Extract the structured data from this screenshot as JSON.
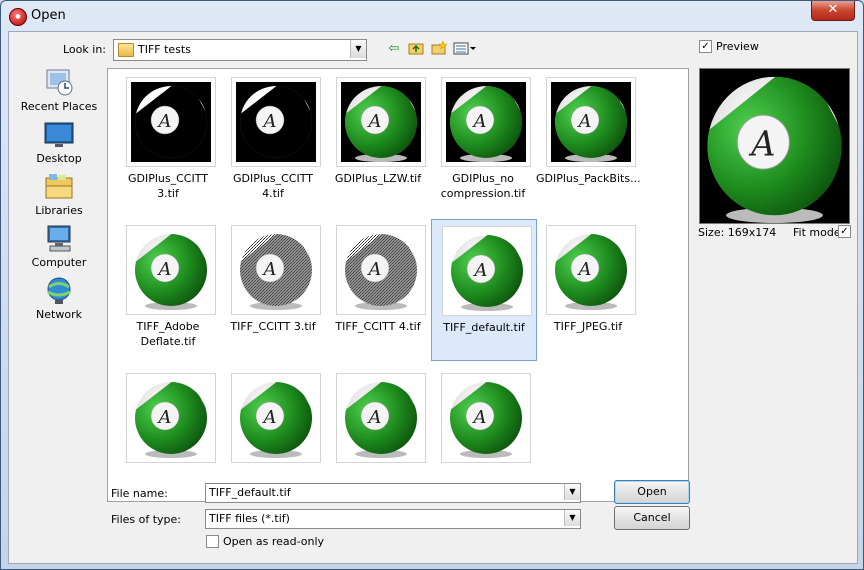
{
  "window": {
    "title": "Open",
    "app_icon": "app-logo-icon",
    "close_label": "✕"
  },
  "toolbar": {
    "look_in_label": "Look in:",
    "look_in_value": "TIFF tests",
    "tools": [
      "back-arrow-icon",
      "up-folder-icon",
      "new-folder-icon",
      "view-menu-icon"
    ]
  },
  "places": [
    {
      "label": "Recent Places",
      "icon": "recent-places-icon"
    },
    {
      "label": "Desktop",
      "icon": "desktop-icon"
    },
    {
      "label": "Libraries",
      "icon": "libraries-icon"
    },
    {
      "label": "Computer",
      "icon": "computer-icon"
    },
    {
      "label": "Network",
      "icon": "network-icon"
    }
  ],
  "files": [
    {
      "name": "GDIPlus_CCITT 3.tif",
      "style": "bw"
    },
    {
      "name": "GDIPlus_CCITT 4.tif",
      "style": "bw"
    },
    {
      "name": "GDIPlus_LZW.tif",
      "style": "green-dark"
    },
    {
      "name": "GDIPlus_no compression.tif",
      "style": "green-dark"
    },
    {
      "name": "GDIPlus_PackBits...",
      "style": "green-dark"
    },
    {
      "name": "TIFF_Adobe Deflate.tif",
      "style": "green"
    },
    {
      "name": "TIFF_CCITT 3.tif",
      "style": "dither"
    },
    {
      "name": "TIFF_CCITT 4.tif",
      "style": "dither"
    },
    {
      "name": "TIFF_default.tif",
      "style": "green",
      "selected": true
    },
    {
      "name": "TIFF_JPEG.tif",
      "style": "green"
    },
    {
      "name": "",
      "style": "green"
    },
    {
      "name": "",
      "style": "green"
    },
    {
      "name": "",
      "style": "green"
    },
    {
      "name": "",
      "style": "green"
    }
  ],
  "form": {
    "file_name_label": "File name:",
    "file_name_value": "TIFF_default.tif",
    "files_of_type_label": "Files of type:",
    "files_of_type_value": "TIFF files (*.tif)",
    "read_only_label": "Open as read-only",
    "read_only_checked": false
  },
  "buttons": {
    "open": "Open",
    "cancel": "Cancel"
  },
  "preview": {
    "label": "Preview",
    "checked": true,
    "size_text": "Size: 169x174",
    "fit_mode_label": "Fit mode",
    "fit_mode_checked": true
  },
  "colors": {
    "ball_green": "#1e8c1e",
    "ball_dark_green": "#0f5f0f",
    "selection": "#dce9fb"
  }
}
